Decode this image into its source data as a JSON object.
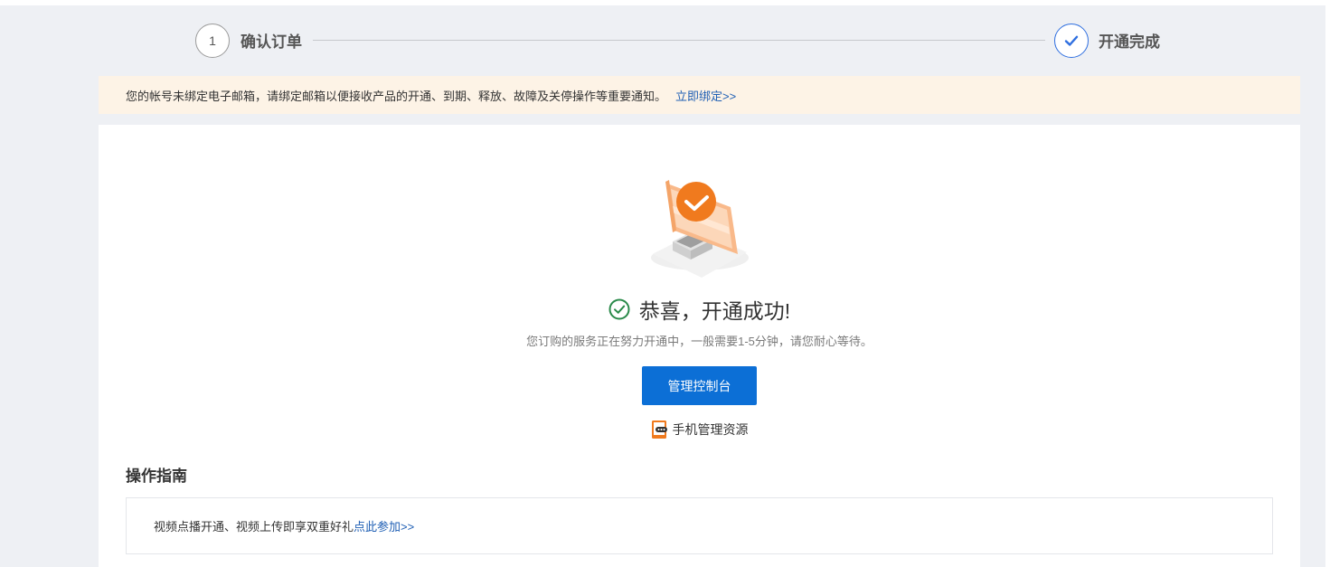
{
  "steps": [
    {
      "number": "1",
      "label": "确认订单"
    },
    {
      "label": "开通完成"
    }
  ],
  "notice": {
    "text": "您的帐号未绑定电子邮箱，请绑定邮箱以便接收产品的开通、到期、释放、故障及关停操作等重要通知。",
    "link": "立即绑定>>"
  },
  "success": {
    "title": "恭喜，开通成功!",
    "subtitle": "您订购的服务正在努力开通中，一般需要1-5分钟，请您耐心等待。",
    "console_button": "管理控制台",
    "mobile_link": "手机管理资源"
  },
  "guide": {
    "title": "操作指南",
    "item_text": "视频点播开通、视频上传即享双重好礼",
    "item_link": "点此参加>>"
  },
  "colors": {
    "accent": "#0c6fd6",
    "link": "#1f5fb4",
    "success": "#2a8a4a",
    "notice_bg": "#fdf3e6",
    "illustration": "#f08a3a"
  }
}
